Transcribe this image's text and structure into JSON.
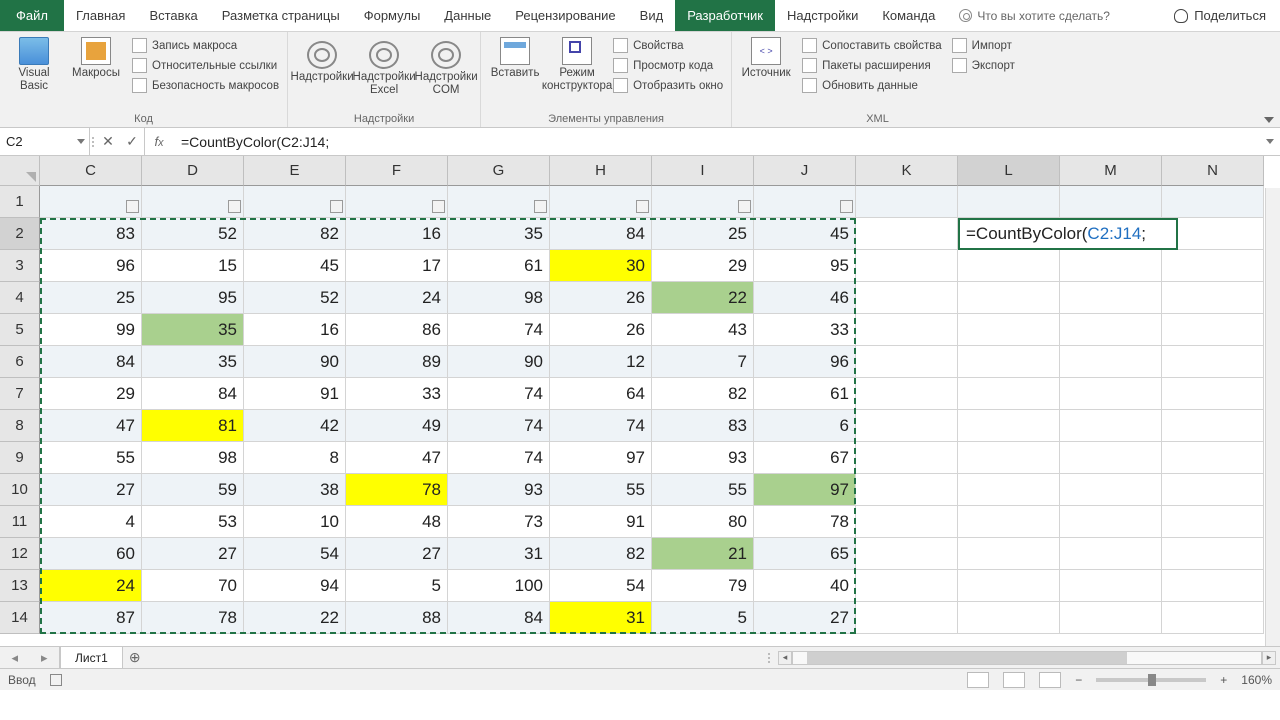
{
  "tabs": {
    "file": "Файл",
    "list": [
      "Главная",
      "Вставка",
      "Разметка страницы",
      "Формулы",
      "Данные",
      "Рецензирование",
      "Вид",
      "Разработчик",
      "Надстройки",
      "Команда"
    ],
    "active_index": 7,
    "tell_me": "Что вы хотите сделать?",
    "share": "Поделиться"
  },
  "ribbon": {
    "group1": {
      "label": "Код",
      "big": [
        "Visual\nBasic",
        "Макросы"
      ],
      "small": [
        "Запись макроса",
        "Относительные ссылки",
        "Безопасность макросов"
      ]
    },
    "group2": {
      "label": "Надстройки",
      "big": [
        "Надстройки",
        "Надстройки\nExcel",
        "Надстройки\nCOM"
      ]
    },
    "group3": {
      "label": "Элементы управления",
      "big": [
        "Вставить",
        "Режим\nконструктора"
      ],
      "small": [
        "Свойства",
        "Просмотр кода",
        "Отобразить окно"
      ]
    },
    "group4": {
      "label": "XML",
      "big": [
        "Источник"
      ],
      "small_left": [
        "Сопоставить свойства",
        "Пакеты расширения",
        "Обновить данные"
      ],
      "small_right": [
        "Импорт",
        "Экспорт"
      ]
    }
  },
  "namebox": "C2",
  "formula": "=CountByColor(C2:J14;",
  "cols": [
    "C",
    "D",
    "E",
    "F",
    "G",
    "H",
    "I",
    "J",
    "K",
    "L",
    "M",
    "N"
  ],
  "rows": [
    "1",
    "2",
    "3",
    "4",
    "5",
    "6",
    "7",
    "8",
    "9",
    "10",
    "11",
    "12",
    "13",
    "14"
  ],
  "editing_text_prefix": "=CountByColor(",
  "editing_text_ref": "C2:J14",
  "editing_text_suffix": ";",
  "grid": [
    [
      83,
      52,
      82,
      16,
      35,
      84,
      25,
      45
    ],
    [
      96,
      15,
      45,
      17,
      61,
      30,
      29,
      95
    ],
    [
      25,
      95,
      52,
      24,
      98,
      26,
      22,
      46
    ],
    [
      99,
      35,
      16,
      86,
      74,
      26,
      43,
      33
    ],
    [
      84,
      35,
      90,
      89,
      90,
      12,
      7,
      96
    ],
    [
      29,
      84,
      91,
      33,
      74,
      64,
      82,
      61
    ],
    [
      47,
      81,
      42,
      49,
      74,
      74,
      83,
      6
    ],
    [
      55,
      98,
      8,
      47,
      74,
      97,
      93,
      67
    ],
    [
      27,
      59,
      38,
      78,
      93,
      55,
      55,
      97
    ],
    [
      4,
      53,
      10,
      48,
      73,
      91,
      80,
      78
    ],
    [
      60,
      27,
      54,
      27,
      31,
      82,
      21,
      65
    ],
    [
      24,
      70,
      94,
      5,
      100,
      54,
      79,
      40
    ],
    [
      87,
      78,
      22,
      88,
      84,
      31,
      5,
      27
    ]
  ],
  "highlights": {
    "yellow": [
      [
        1,
        5
      ],
      [
        6,
        1
      ],
      [
        8,
        3
      ],
      [
        11,
        0
      ],
      [
        12,
        5
      ]
    ],
    "green": [
      [
        2,
        6
      ],
      [
        3,
        1
      ],
      [
        8,
        7
      ],
      [
        10,
        6
      ]
    ]
  },
  "sheet_tab": "Лист1",
  "status_mode": "Ввод",
  "zoom": "160%"
}
